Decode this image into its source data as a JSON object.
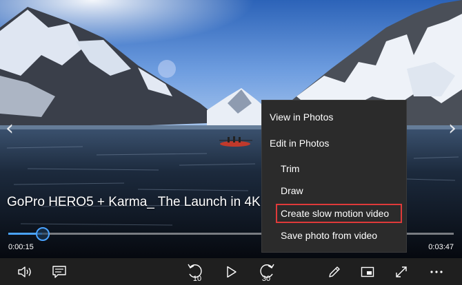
{
  "video": {
    "title": "GoPro HERO5 + Karma_ The Launch in 4K",
    "elapsed": "0:00:15",
    "total": "0:03:47",
    "progress": 0.076
  },
  "context_menu": {
    "items": [
      {
        "label": "View in Photos"
      },
      {
        "label": "Edit in Photos"
      },
      {
        "label": "Trim"
      },
      {
        "label": "Draw"
      },
      {
        "label": "Create slow motion video"
      },
      {
        "label": "Save photo from video"
      }
    ],
    "highlighted_index": 4,
    "highlight_color": "#e03a3a"
  },
  "controls": {
    "skip_back_seconds": "10",
    "skip_forward_seconds": "30",
    "icons": [
      "volume-icon",
      "subtitles-icon",
      "skip-back-icon",
      "play-icon",
      "skip-forward-icon",
      "pen-icon",
      "mini-view-icon",
      "fullscreen-icon",
      "more-icon"
    ]
  },
  "colors": {
    "accent": "#4aa3ff",
    "menu_background": "#2b2b2b",
    "controls_background": "#1f1f1f"
  }
}
